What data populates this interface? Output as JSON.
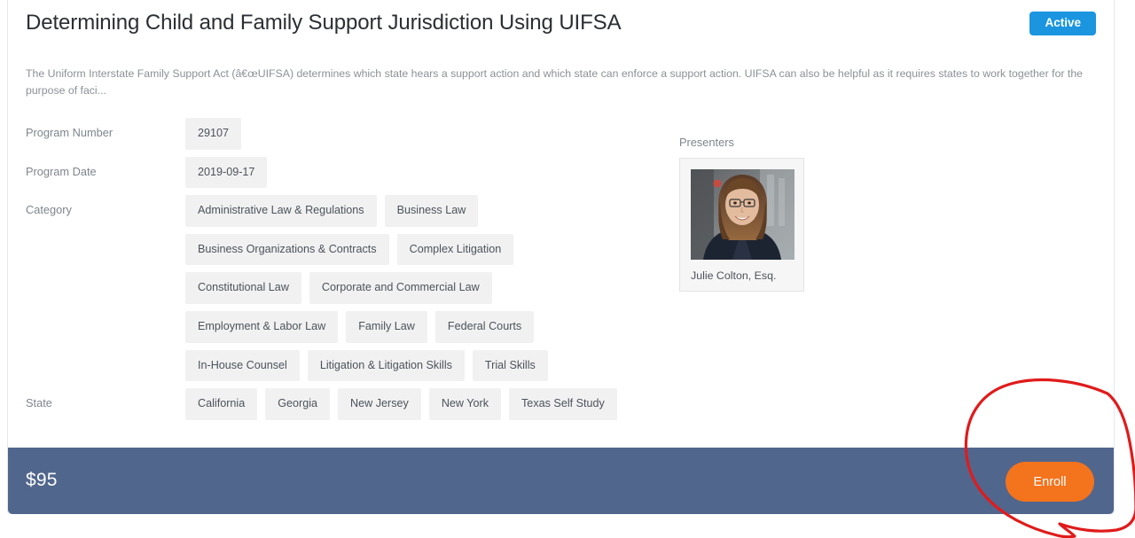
{
  "header": {
    "title": "Determining Child and Family Support Jurisdiction Using UIFSA",
    "status_badge": "Active",
    "status_color": "#1b95e0"
  },
  "description": "The Uniform Interstate Family Support Act (â€œUIFSA) determines which state hears a support action and which state can enforce a support action. UIFSA can also be helpful as it requires states to work together for the purpose of faci...",
  "details": {
    "program_number": {
      "label": "Program Number",
      "values": [
        "29107"
      ]
    },
    "program_date": {
      "label": "Program Date",
      "values": [
        "2019-09-17"
      ]
    },
    "category": {
      "label": "Category",
      "values": [
        "Administrative Law & Regulations",
        "Business Law",
        "Business Organizations & Contracts",
        "Complex Litigation",
        "Constitutional Law",
        "Corporate and Commercial Law",
        "Employment & Labor Law",
        "Family Law",
        "Federal Courts",
        "In-House Counsel",
        "Litigation & Litigation Skills",
        "Trial Skills"
      ]
    },
    "state": {
      "label": "State",
      "values": [
        "California",
        "Georgia",
        "New Jersey",
        "New York",
        "Texas Self Study"
      ]
    }
  },
  "presenters": {
    "label": "Presenters",
    "people": [
      {
        "name": "Julie  Colton, Esq.",
        "photo_alt": "headshot-photo"
      }
    ]
  },
  "footer": {
    "price": "$95",
    "enroll_label": "Enroll",
    "bar_color": "#51668d",
    "enroll_color": "#f4731d"
  },
  "annotation": {
    "shape": "hand-drawn-circle",
    "color": "#e01b1b",
    "target": "enroll-button"
  }
}
